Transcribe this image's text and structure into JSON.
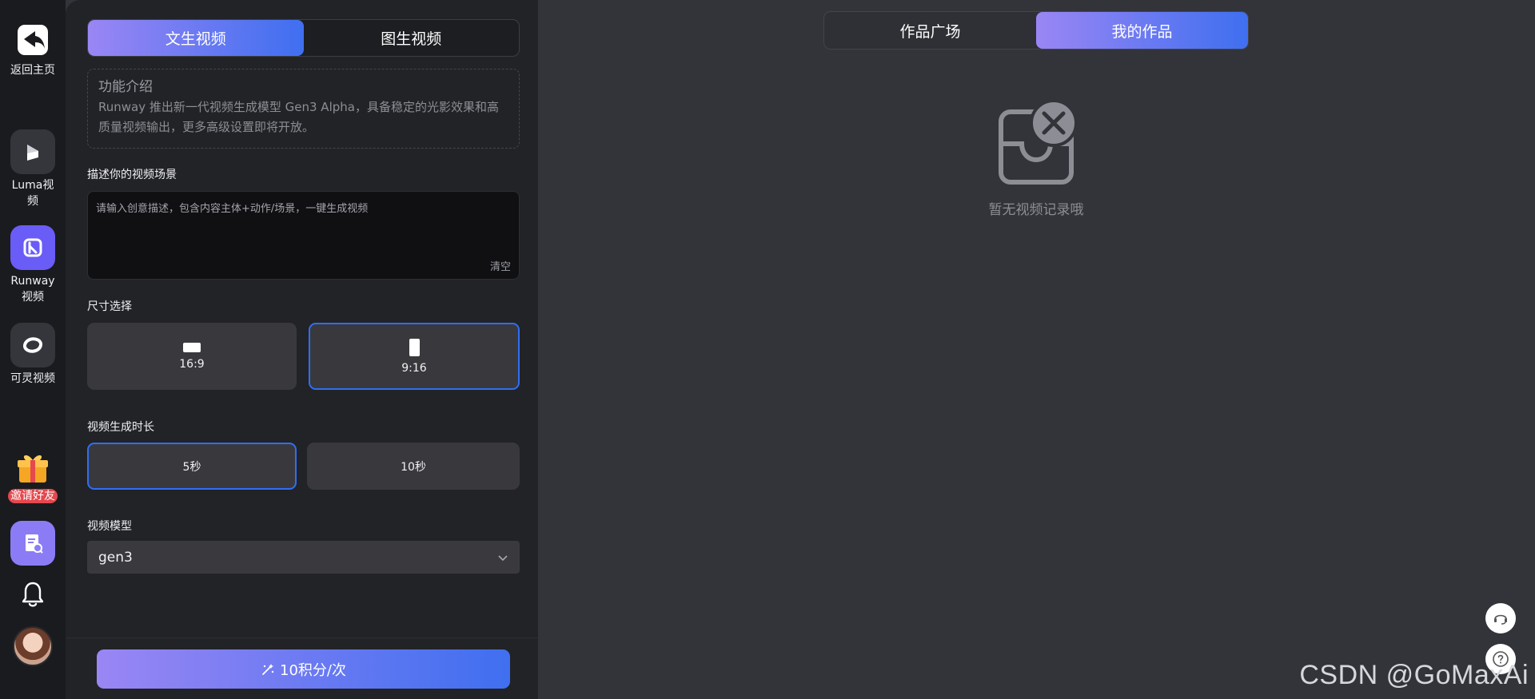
{
  "rail": {
    "back_label": "返回主页",
    "items": [
      {
        "label": "Luma视频",
        "icon": "luma-logo-icon"
      },
      {
        "label": "Runway视频",
        "icon": "runway-logo-icon",
        "accent": "#6a5cf6"
      },
      {
        "label": "可灵视频",
        "icon": "kling-logo-icon"
      }
    ],
    "gift_label": "邀请好友"
  },
  "panel": {
    "tabs": [
      {
        "label": "文生视频",
        "active": true
      },
      {
        "label": "图生视频",
        "active": false
      }
    ],
    "intro": {
      "title": "功能介绍",
      "text": "Runway 推出新一代视频生成模型 Gen3 Alpha，具备稳定的光影效果和高质量视频输出，更多高级设置即将开放。"
    },
    "prompt": {
      "label": "描述你的视频场景",
      "value": "",
      "placeholder": "请输入创意描述，包含内容主体+动作/场景，一键生成视频",
      "clear_label": "清空"
    },
    "size": {
      "label": "尺寸选择",
      "options": [
        {
          "label": "16:9",
          "selected": false
        },
        {
          "label": "9:16",
          "selected": true
        }
      ]
    },
    "duration": {
      "label": "视频生成时长",
      "options": [
        {
          "label": "5秒",
          "selected": true
        },
        {
          "label": "10秒",
          "selected": false
        }
      ]
    },
    "model": {
      "label": "视频模型",
      "value": "gen3"
    },
    "generate_label": "10积分/次"
  },
  "main": {
    "tabs": [
      {
        "label": "作品广场",
        "active": false
      },
      {
        "label": "我的作品",
        "active": true
      }
    ],
    "empty_text": "暂无视频记录哦"
  },
  "watermark": "CSDN @GoMaxAi",
  "colors": {
    "accent_gradient_start": "#9a86f4",
    "accent_gradient_end": "#3f6ff0",
    "selected_border": "#2f6ef5"
  }
}
